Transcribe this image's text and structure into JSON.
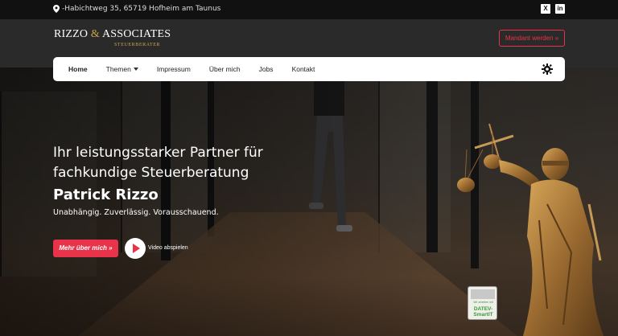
{
  "topbar": {
    "address": "-Habichtweg 35, 65719 Hofheim am Taunus",
    "social": [
      {
        "icon": "xing-icon",
        "glyph": "X"
      },
      {
        "icon": "linkedin-icon",
        "glyph": "in"
      }
    ]
  },
  "logo": {
    "name_part1": "RIZZO",
    "amp": "&",
    "name_part2": "ASSOCIATES",
    "subtitle": "STEUERBERATER"
  },
  "header": {
    "cta_label": "Mandant werden »"
  },
  "nav": {
    "items": [
      {
        "label": "Home",
        "active": true
      },
      {
        "label": "Themen",
        "dropdown": true
      },
      {
        "label": "Impressum"
      },
      {
        "label": "Über mich"
      },
      {
        "label": "Jobs"
      },
      {
        "label": "Kontakt"
      }
    ],
    "theme_toggle_icon": "gear-icon"
  },
  "hero": {
    "headline_line1": "Ihr leistungsstarker Partner für",
    "headline_line2": "fachkundige Steuerberatung",
    "name": "Patrick Rizzo",
    "tagline": "Unabhängig. Zuverlässig. Vorausschauend.",
    "more_button": "Mehr über mich »",
    "video_label": "Video abspielen"
  },
  "badge": {
    "small_text": "Wir arbeiten mit",
    "brand_line1": "DATEV-",
    "brand_line2": "SmartIT"
  },
  "colors": {
    "accent": "#e8334a",
    "gold": "#c9a74c",
    "topbar_bg": "#111111",
    "header_bg": "#2a2a2a"
  }
}
